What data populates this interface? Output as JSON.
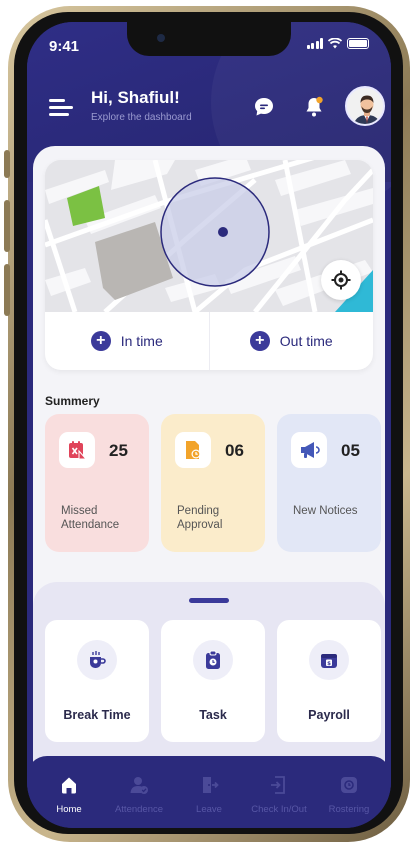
{
  "status_bar": {
    "time": "9:41"
  },
  "header": {
    "greeting": "Hi, Shafiul!",
    "subtitle": "Explore the dashboard",
    "icons": [
      "menu-icon",
      "chat-icon",
      "bell-icon",
      "avatar"
    ]
  },
  "map_card": {
    "in_time_label": "In time",
    "out_time_label": "Out time"
  },
  "summary": {
    "title": "Summery",
    "cards": [
      {
        "count": "25",
        "label": "Missed Attendance",
        "icon": "missed-calendar-icon",
        "bg": "#f9dede",
        "icon_color": "#e0445a"
      },
      {
        "count": "06",
        "label": "Pending Approval",
        "icon": "pending-file-icon",
        "bg": "#fbeccb",
        "icon_color": "#f2a42b"
      },
      {
        "count": "05",
        "label": "New Notices",
        "icon": "megaphone-icon",
        "bg": "#e2e7f6",
        "icon_color": "#4458b8"
      }
    ]
  },
  "actions": [
    {
      "label": "Break Time",
      "icon": "coffee-icon"
    },
    {
      "label": "Task",
      "icon": "clipboard-icon"
    },
    {
      "label": "Payroll",
      "icon": "wallet-icon"
    }
  ],
  "tabbar": {
    "items": [
      {
        "label": "Home",
        "icon": "home-icon",
        "active": true
      },
      {
        "label": "Attendence",
        "icon": "user-check-icon",
        "active": false
      },
      {
        "label": "Leave",
        "icon": "exit-door-icon",
        "active": false
      },
      {
        "label": "Check In/Out",
        "icon": "check-in-out-icon",
        "active": false
      },
      {
        "label": "Rostering",
        "icon": "roster-icon",
        "active": false
      }
    ]
  },
  "colors": {
    "primary": "#2b2a7c",
    "accent": "#3b3a9a",
    "background": "#f4f4f8"
  }
}
